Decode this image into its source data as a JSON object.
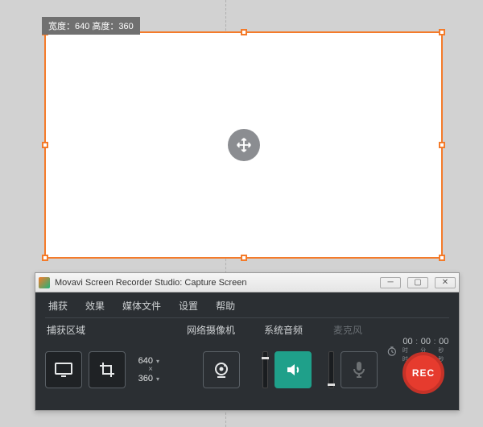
{
  "capture": {
    "width_label": "宽度：",
    "width_value": "640",
    "between": "  ",
    "height_label": "高度：",
    "height_value": "360"
  },
  "window": {
    "title": "Movavi Screen Recorder Studio: Capture Screen",
    "buttons": {
      "min": "─",
      "max": "▢",
      "close": "✕"
    }
  },
  "menu": {
    "capture": "捕获",
    "effects": "效果",
    "media": "媒体文件",
    "settings": "设置",
    "help": "帮助"
  },
  "section_labels": {
    "area": "捕获区域",
    "webcam": "网络摄像机",
    "sysaudio": "系统音频",
    "mic": "麦克风"
  },
  "dims": {
    "w": "640",
    "h": "360",
    "x": "×"
  },
  "timer": {
    "h": "00",
    "m": "00",
    "s": "00",
    "hu": "时时",
    "mu": "分分",
    "su": "秒秒",
    "sep": ":"
  },
  "rec_label": "REC"
}
